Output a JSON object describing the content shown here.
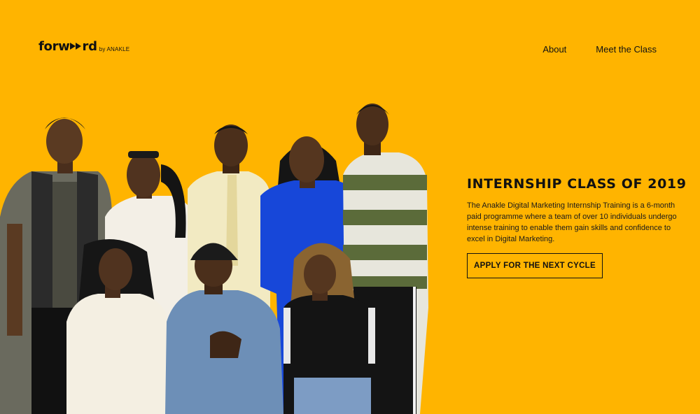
{
  "header": {
    "logo_word": "forward",
    "logo_suffix": "by ANAKLE",
    "nav": [
      {
        "label": "About"
      },
      {
        "label": "Meet the Class"
      }
    ]
  },
  "hero": {
    "headline": "INTERNSHIP CLASS OF 2019",
    "description": "The Anakle Digital Marketing Internship Training is a 6-month paid programme where a team of over 10 individuals undergo intense training to enable them gain skills and confidence to excel in Digital Marketing.",
    "cta_label": "APPLY FOR THE NEXT CYCLE"
  },
  "colors": {
    "background": "#FFB400",
    "text": "#111111"
  }
}
